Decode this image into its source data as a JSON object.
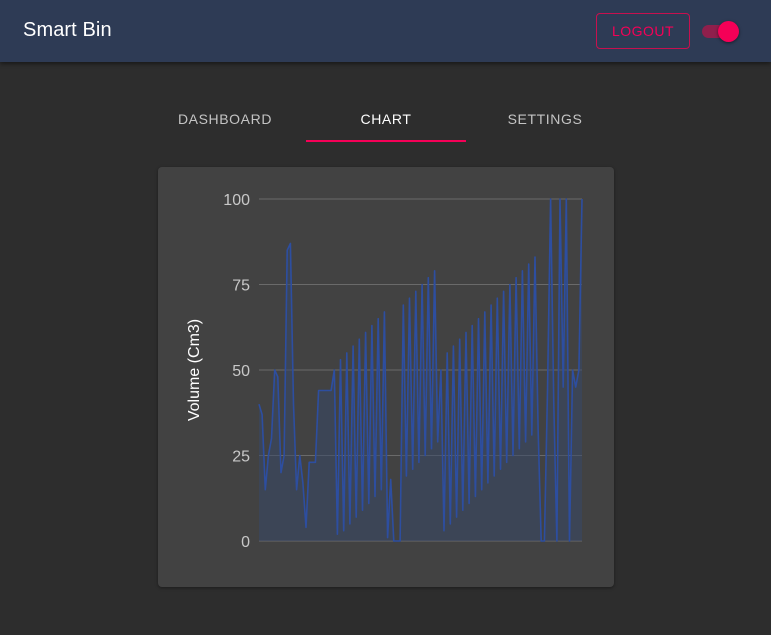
{
  "header": {
    "title": "Smart Bin",
    "logout_label": "LOGOUT",
    "theme_toggle_on": true
  },
  "tabs": [
    {
      "label": "DASHBOARD",
      "active": false
    },
    {
      "label": "CHART",
      "active": true
    },
    {
      "label": "SETTINGS",
      "active": false
    }
  ],
  "colors": {
    "appbar": "#2e3b55",
    "background": "#2d2d2d",
    "card": "#424242",
    "accent": "#f50057",
    "series_line": "#2d4ea0",
    "series_fill": "#394868"
  },
  "chart_data": {
    "type": "area",
    "title": "",
    "xlabel": "",
    "ylabel": "Volume (Cm3)",
    "ylim": [
      0,
      100
    ],
    "yticks": [
      0,
      25,
      50,
      75,
      100
    ],
    "grid": true,
    "series": [
      {
        "values": [
          40,
          37,
          15,
          25,
          30,
          50,
          48,
          20,
          25,
          85,
          87,
          40,
          15,
          25,
          17,
          4,
          23,
          23,
          23,
          44,
          44,
          44,
          44,
          44,
          50,
          2,
          53,
          3,
          55,
          5,
          57,
          7,
          59,
          9,
          61,
          11,
          63,
          13,
          65,
          15,
          67,
          1,
          18,
          0,
          0,
          0,
          69,
          19,
          71,
          21,
          73,
          23,
          75,
          25,
          77,
          27,
          79,
          29,
          50,
          3,
          55,
          5,
          57,
          7,
          59,
          9,
          61,
          11,
          63,
          13,
          65,
          15,
          67,
          17,
          69,
          19,
          71,
          21,
          73,
          23,
          75,
          25,
          77,
          27,
          79,
          29,
          81,
          31,
          83,
          33,
          0,
          0,
          44,
          100,
          40,
          0,
          100,
          45,
          100,
          0,
          50,
          45,
          50,
          100
        ]
      }
    ]
  }
}
